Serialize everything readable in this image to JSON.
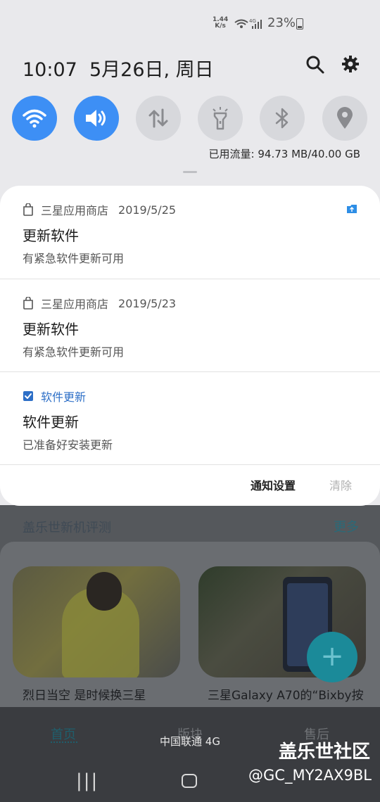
{
  "status_bar": {
    "net_speed_value": "1.44",
    "net_speed_unit": "K/s",
    "battery_percent": "23%"
  },
  "header": {
    "time": "10:07",
    "date": "5月26日, 周日"
  },
  "quick_settings": {
    "toggles": [
      {
        "name": "wifi",
        "state": "on",
        "icon": "wifi-icon"
      },
      {
        "name": "sound",
        "state": "on",
        "icon": "sound-icon"
      },
      {
        "name": "mobile-data",
        "state": "off",
        "icon": "data-arrows-icon"
      },
      {
        "name": "flashlight",
        "state": "off",
        "icon": "flashlight-icon"
      },
      {
        "name": "bluetooth",
        "state": "off",
        "icon": "bluetooth-icon"
      },
      {
        "name": "location",
        "state": "off",
        "icon": "location-icon"
      }
    ],
    "data_usage": "已用流量: 94.73 MB/40.00 GB"
  },
  "notifications": [
    {
      "app": "三星应用商店",
      "date": "2019/5/25",
      "title": "更新软件",
      "body": "有紧急软件更新可用",
      "icon": "store-bag-icon"
    },
    {
      "app": "三星应用商店",
      "date": "2019/5/23",
      "title": "更新软件",
      "body": "有紧急软件更新可用",
      "icon": "store-bag-icon"
    },
    {
      "app": "软件更新",
      "date": "",
      "title": "软件更新",
      "body": "已准备好安装更新",
      "icon": "checkbox-icon"
    }
  ],
  "panel_actions": {
    "settings": "通知设置",
    "clear": "清除"
  },
  "background_app": {
    "section_title": "盖乐世新机评测",
    "more": "更多",
    "card1_caption": "烈日当空 是时候换三星",
    "card2_caption": "三星Galaxy A70的“Bixby按",
    "tabs": [
      "首页",
      "版块",
      "售后"
    ],
    "carrier": "中国联通 4G"
  },
  "watermark": {
    "line1": "盖乐世社区",
    "line2": "@GC_MY2AX9BL"
  },
  "colors": {
    "toggle_on": "#3d8ff5",
    "toggle_off": "#d7d8dc",
    "accent_blue": "#2d6fc7"
  }
}
